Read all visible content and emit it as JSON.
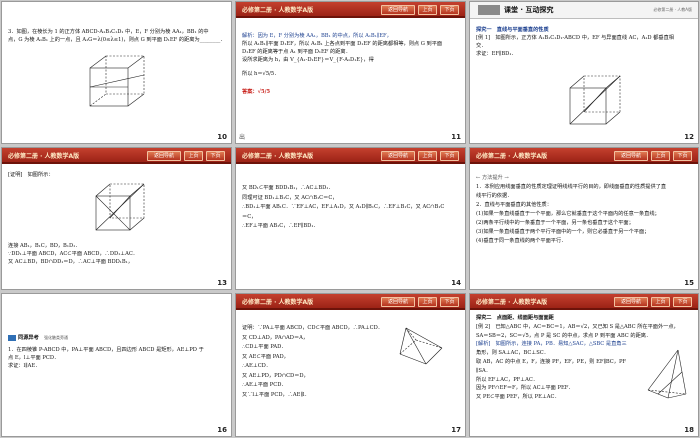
{
  "header": {
    "title": "必修第二册 · 人教数学A版",
    "back": "返回导航",
    "prev": "上页",
    "next": "下页"
  },
  "slides": [
    {
      "num": "10",
      "lines": [
        "3．如图，在棱长为 1 的正方体 ABCD-A₁B₁C₁D₁ 中，E，F 分别为棱 AA₁，BB₁ 的中",
        "点，G 为棱 A₁B₁ 上的一点，且 A₁G＝λ(0≤λ≤1)，则点 G 到平面 D₁EF 的距离为________．"
      ]
    },
    {
      "num": "11",
      "lines": [
        "解析：因为 E，F 分别为棱 AA₁，BB₁ 的中点，所以 A₁B₁∥EF，",
        "所以 A₁B₁∥平面 D₁EF，所以 A₁B₁ 上各点到平面 D₁EF 的距离都相等，则点 G 到平面",
        "D₁EF 的距离等于点 A₁ 到平面 D₁EF 的距离．",
        "设所求距离为 h，由 V_{A₁-D₁EF}＝V_{F-A₁D₁E}，得",
        "所以 h＝√5/5．",
        "答案：√5/5"
      ],
      "footer": "出"
    },
    {
      "num": "12",
      "section_title": "课堂 · 互动探究",
      "section_small": "必修第二册 · 人教A版",
      "lines": [
        "探究一　直线与平面垂直的性质",
        "[例 1]　如图所示，正方体 A₁B₁C₁D₁-ABCD 中，EF 与异面直线 AC，A₁D 都垂直相",
        "交．",
        "求证：EF∥BD₁．"
      ]
    },
    {
      "num": "13",
      "lines": [
        "[证明]　如图所示：",
        "连接 AB₁，B₁C，BD，B₁D₁．",
        "∵DD₁⊥平面 ABCD，AC⊂平面 ABCD，∴DD₁⊥AC．",
        "又 AC⊥BD，BD∩DD₁＝D，∴AC⊥平面 BDD₁B₁，"
      ]
    },
    {
      "num": "14",
      "lines": [
        "又 BD₁⊂平面 BDD₁B₁，∴AC⊥BD₁．",
        "同理可证 BD₁⊥B₁C，又 AC∩B₁C＝C，",
        "∴BD₁⊥平面 AB₁C．∵EF⊥AC，EF⊥A₁D，又 A₁D∥B₁C，∴EF⊥B₁C，又 AC∩B₁C",
        "＝C，",
        "∴EF⊥平面 AB₁C，∴EF∥BD₁．"
      ]
    },
    {
      "num": "15",
      "lines": [
        "← 方法提升 →",
        "1．本例应用线面垂直的性质定理证明线线平行的目的，即线面垂直的性质提供了直",
        "线平行的依据．",
        "2．直线与平面垂直的其他性质：",
        "(1)如果一条直线垂直于一个平面，那么它就垂直于这个平面内的任意一条直线；",
        "(2)两条平行线中的一条垂直于一个平面，另一条也垂直于这个平面；",
        "(3)如果一条直线垂直于两个平行平面中的一个，则它必垂直于另一个平面；",
        "(4)垂直于同一条直线的两个平面平行．"
      ]
    },
    {
      "num": "16",
      "tag": "同源异考　",
      "tag_sub": "强化触类旁通",
      "lines": [
        "1．在四棱锥 P-ABCD 中，PA⊥平面 ABCD，且四边形 ABCD 是矩形，AE⊥PD 于",
        "点 E，l⊥平面 PCD．",
        "求证：l∥AE．"
      ]
    },
    {
      "num": "17",
      "lines": [
        "证明：∵PA⊥平面 ABCD，CD⊂平面 ABCD，∴PA⊥CD．",
        "又 CD⊥AD，PA∩AD＝A，",
        "∴CD⊥平面 PAD．",
        "又 AE⊂平面 PAD，",
        "∴AE⊥CD．",
        "又 AE⊥PD，PD∩CD＝D，",
        "∴AE⊥平面 PCD．",
        "又∵l⊥平面 PCD，∴AE∥l．"
      ]
    },
    {
      "num": "18",
      "lines": [
        "探究二　点面距、线面距与面面距",
        "[例 2]　已知△ABC 中，AC＝BC＝1，AB＝√2，又已知 S 是△ABC 所在平面外一点，",
        "SA＝SB＝2，SC＝√5，点 P 是 SC 的中点，求点 P 到平面 ABC 的距离．",
        "[解析]　如图所示，连接 PA，PB．易知△SAC，△SBC 是直角三",
        "角形，则 SA⊥AC，BC⊥SC．",
        "取 AB，AC 的中点 E，F，连接 PF，EF，PE，则 EF∥BC，PF",
        "∥SA．",
        "所以 EF⊥AC，PF⊥AC．",
        "因为 PF∩EF＝F，所以 AC⊥平面 PEF．",
        "又 PE⊂平面 PEF，所以 PE⊥AC．"
      ]
    }
  ]
}
